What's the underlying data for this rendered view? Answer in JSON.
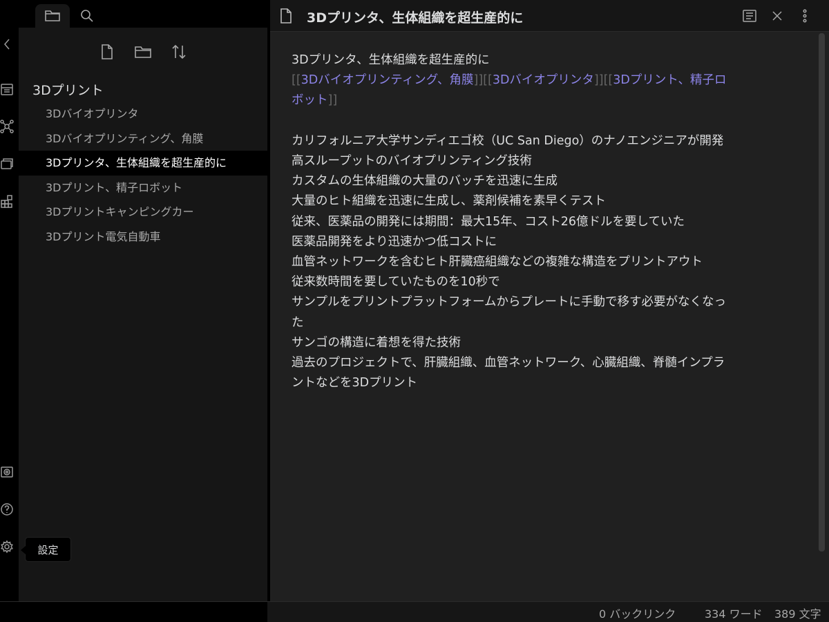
{
  "ribbon": {
    "icons": [
      "chevron-left-icon",
      "calendar-icon",
      "graph-icon",
      "cards-icon",
      "grid-icon",
      "vault-icon",
      "help-icon",
      "gear-icon"
    ]
  },
  "sidebar": {
    "folder_title": "3Dプリント",
    "files": [
      {
        "label": "3Dバイオプリンタ",
        "active": false
      },
      {
        "label": "3Dバイオプリンティング、角膜",
        "active": false
      },
      {
        "label": "3Dプリンタ、生体組織を超生産的に",
        "active": true
      },
      {
        "label": "3Dプリント、精子ロボット",
        "active": false
      },
      {
        "label": "3Dプリントキャンピングカー",
        "active": false
      },
      {
        "label": "3Dプリント電気自動車",
        "active": false
      }
    ]
  },
  "main": {
    "title": "3Dプリンタ、生体組織を超生産的に",
    "content": {
      "first_line": "3Dプリンタ、生体組織を超生産的に",
      "links": {
        "open": "[[",
        "close": "]]",
        "link1": "3Dバイオプリンティング、角膜",
        "link2": "3Dバイオプリンタ",
        "link3_a": "3Dプリント、精子ロ",
        "link3_b": "ボット"
      },
      "lines": [
        "カリフォルニア大学サンディエゴ校（UC San Diego）のナノエンジニアが開発",
        "高スループットのバイオプリンティング技術",
        "カスタムの生体組織の大量のバッチを迅速に生成",
        "大量のヒト組織を迅速に生成し、薬剤候補を素早くテスト",
        "従来、医薬品の開発には期間：最大15年、コスト26億ドルを要していた",
        "医薬品開発をより迅速かつ低コストに",
        "血管ネットワークを含むヒト肝臓癌組織などの複雑な構造をプリントアウト",
        "従来数時間を要していたものを10秒で",
        "サンプルをプリントプラットフォームからプレートに手動で移す必要がなくなっ",
        "た",
        "サンゴの構造に着想を得た技術",
        "過去のプロジェクトで、肝臓組織、血管ネットワーク、心臓組織、脊髄インプラ",
        "ントなどを3Dプリント"
      ]
    }
  },
  "status": {
    "backlinks": "0 バックリンク",
    "words": "334 ワード",
    "chars": "389 文字"
  },
  "tooltip": {
    "label": "設定"
  },
  "colors": {
    "link": "#8b83e6",
    "background": "#202020",
    "sidebar": "#161616"
  }
}
